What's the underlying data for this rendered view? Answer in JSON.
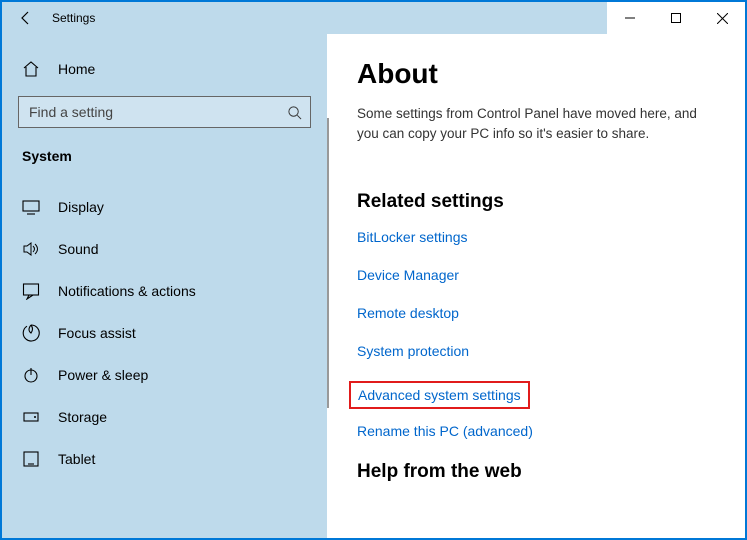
{
  "window": {
    "title": "Settings"
  },
  "sidebar": {
    "home": "Home",
    "search_placeholder": "Find a setting",
    "category": "System",
    "items": [
      {
        "label": "Display"
      },
      {
        "label": "Sound"
      },
      {
        "label": "Notifications & actions"
      },
      {
        "label": "Focus assist"
      },
      {
        "label": "Power & sleep"
      },
      {
        "label": "Storage"
      },
      {
        "label": "Tablet"
      }
    ]
  },
  "main": {
    "title": "About",
    "description": "Some settings from Control Panel have moved here, and you can copy your PC info so it's easier to share.",
    "related_heading": "Related settings",
    "links": [
      "BitLocker settings",
      "Device Manager",
      "Remote desktop",
      "System protection",
      "Advanced system settings",
      "Rename this PC (advanced)"
    ],
    "help_heading": "Help from the web"
  }
}
